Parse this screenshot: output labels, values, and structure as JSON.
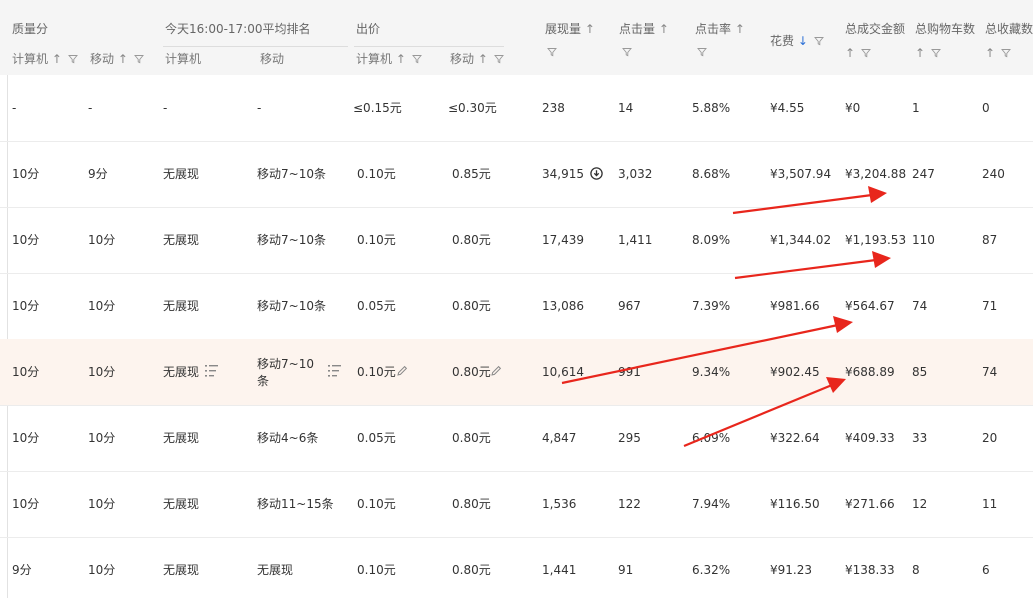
{
  "headers": {
    "quality": "质量分",
    "rank": "今天16:00-17:00平均排名",
    "bid": "出价",
    "impressions": "展现量",
    "clicks": "点击量",
    "ctr": "点击率",
    "cost": "花费",
    "gmv": "总成交金额",
    "cart": "总购物车数",
    "fav": "总收藏数",
    "computer": "计算机",
    "mobile": "移动",
    "sort_up": "↑",
    "sort_down": "↓"
  },
  "rows": [
    {
      "q_pc": "-",
      "q_m": "-",
      "r_pc": "-",
      "r_m": "-",
      "b_pc": "≤0.15元",
      "b_m": "≤0.30元",
      "imp": "238",
      "clk": "14",
      "ctr": "5.88%",
      "cost": "¥4.55",
      "gmv": "¥0",
      "cart": "1",
      "fav": "0"
    },
    {
      "q_pc": "10分",
      "q_m": "9分",
      "r_pc": "无展现",
      "r_m": "移动7~10条",
      "b_pc": "0.10元",
      "b_m": "0.85元",
      "imp": "34,915",
      "clk": "3,032",
      "ctr": "8.68%",
      "cost": "¥3,507.94",
      "gmv": "¥3,204.88",
      "cart": "247",
      "fav": "240"
    },
    {
      "q_pc": "10分",
      "q_m": "10分",
      "r_pc": "无展现",
      "r_m": "移动7~10条",
      "b_pc": "0.10元",
      "b_m": "0.80元",
      "imp": "17,439",
      "clk": "1,411",
      "ctr": "8.09%",
      "cost": "¥1,344.02",
      "gmv": "¥1,193.53",
      "cart": "110",
      "fav": "87"
    },
    {
      "q_pc": "10分",
      "q_m": "10分",
      "r_pc": "无展现",
      "r_m": "移动7~10条",
      "b_pc": "0.05元",
      "b_m": "0.80元",
      "imp": "13,086",
      "clk": "967",
      "ctr": "7.39%",
      "cost": "¥981.66",
      "gmv": "¥564.67",
      "cart": "74",
      "fav": "71"
    },
    {
      "q_pc": "10分",
      "q_m": "10分",
      "r_pc": "无展现",
      "r_m_1": "移动7~10",
      "r_m_2": "条",
      "b_pc": "0.10元",
      "b_m": "0.80元",
      "imp": "10,614",
      "clk": "991",
      "ctr": "9.34%",
      "cost": "¥902.45",
      "gmv": "¥688.89",
      "cart": "85",
      "fav": "74"
    },
    {
      "q_pc": "10分",
      "q_m": "10分",
      "r_pc": "无展现",
      "r_m": "移动4~6条",
      "b_pc": "0.05元",
      "b_m": "0.80元",
      "imp": "4,847",
      "clk": "295",
      "ctr": "6.09%",
      "cost": "¥322.64",
      "gmv": "¥409.33",
      "cart": "33",
      "fav": "20"
    },
    {
      "q_pc": "10分",
      "q_m": "10分",
      "r_pc": "无展现",
      "r_m": "移动11~15条",
      "b_pc": "0.10元",
      "b_m": "0.80元",
      "imp": "1,536",
      "clk": "122",
      "ctr": "7.94%",
      "cost": "¥116.50",
      "gmv": "¥271.66",
      "cart": "12",
      "fav": "11"
    },
    {
      "q_pc": "9分",
      "q_m": "10分",
      "r_pc": "无展现",
      "r_m": "无展现",
      "b_pc": "0.10元",
      "b_m": "0.80元",
      "imp": "1,441",
      "clk": "91",
      "ctr": "6.32%",
      "cost": "¥91.23",
      "gmv": "¥138.33",
      "cart": "8",
      "fav": "6"
    }
  ],
  "colors": {
    "annotation_arrow": "#e8261c",
    "highlight_row": "#fdf4ee",
    "sort_active": "#2b6fd6"
  },
  "icons": [
    "download-icon",
    "list-sort-icon",
    "edit-pencil-icon",
    "filter-icon"
  ]
}
